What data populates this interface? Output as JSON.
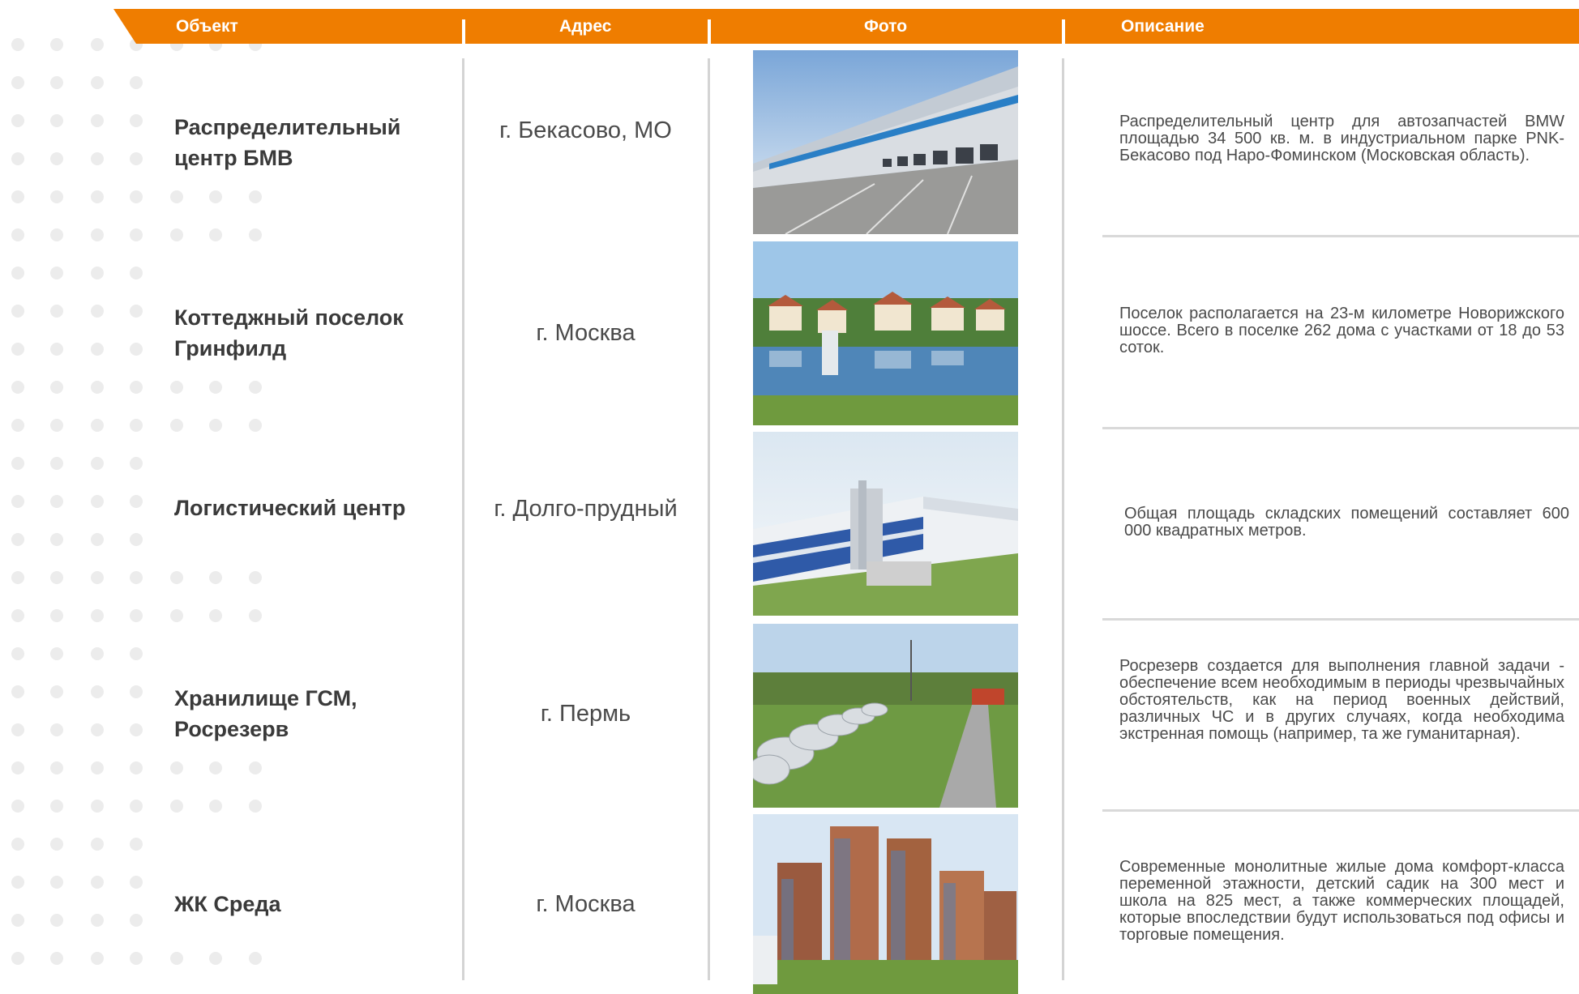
{
  "header": {
    "col_object": "Объект",
    "col_address": "Адрес",
    "col_photo": "Фото",
    "col_description": "Описание"
  },
  "rows": [
    {
      "object": "Распределительный центр БМВ",
      "address": "г. Бекасово, МО",
      "photo": "warehouse-photo",
      "description": "Распределительный центр для автозапчастей BMW площадью 34 500 кв. м. в индустриальном парке PNK-Бекасово под Наро-Фоминском (Московская область)."
    },
    {
      "object": "Коттеджный поселок Гринфилд",
      "address": "г. Москва",
      "photo": "cottage-village-photo",
      "description": "Поселок располагается на 23-м километре Новорижского шоссе. Всего в поселке 262 дома с участками от 18 до 53 соток."
    },
    {
      "object": "Логистический центр",
      "address": "г. Долго-прудный",
      "photo": "logistics-center-photo",
      "description": "Общая площадь складских помещений составляет 600 000 квадратных метров."
    },
    {
      "object": "Хранилище ГСМ, Росрезерв",
      "address": "г. Пермь",
      "photo": "fuel-tanks-photo",
      "description": "Росрезерв создается для выполнения главной задачи - обеспечение всем необходимым в периоды чрезвычайных обстоятельств, как на период военных действий, различных ЧС и в других случаях, когда необходима экстренная помощь (например, та же гуманитарная)."
    },
    {
      "object": "ЖК Среда",
      "address": "г. Москва",
      "photo": "residential-towers-photo",
      "description": "Современные монолитные жилые дома комфорт-класса переменной этажности, детский садик на 300 мест и школа на 825 мест, а также коммерческих площадей, которые впоследствии будут использоваться под офисы и торговые помещения."
    }
  ],
  "colors": {
    "accent": "#ef7d00",
    "divider": "#d4d4d4",
    "dot": "#ececec"
  }
}
